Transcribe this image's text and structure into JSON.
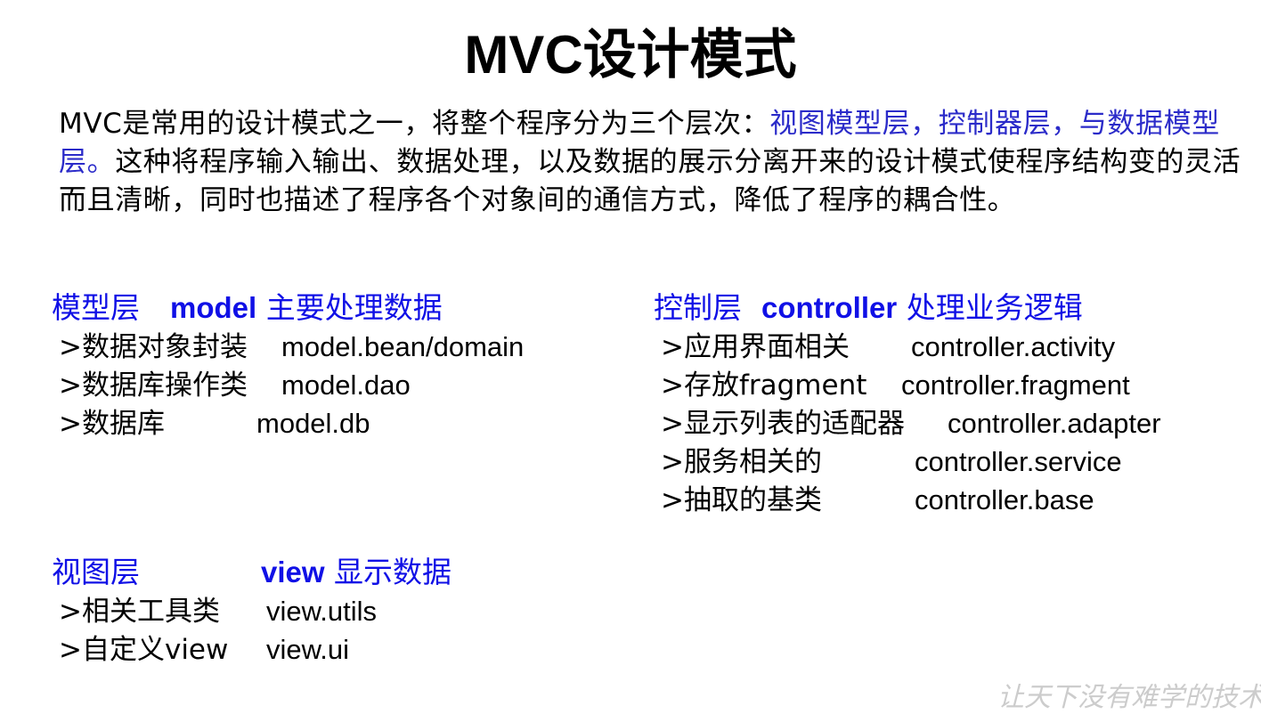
{
  "title": "MVC设计模式",
  "intro": {
    "part1": "MVC是常用的设计模式之一，将整个程序分为三个层次：",
    "highlight": "视图模型层，控制器层，与数据模型层。",
    "part2": "这种将程序输入输出、数据处理，以及数据的展示分离开来的设计模式使程序结构变的灵活而且清晰，同时也描述了程序各个对象间的通信方式，降低了程序的耦合性。"
  },
  "model": {
    "heading_label": "模型层",
    "heading_code": "model",
    "heading_desc": "主要处理数据",
    "items": [
      {
        "label": ">数据对象封装",
        "package": "model.bean/domain"
      },
      {
        "label": ">数据库操作类",
        "package": "model.dao"
      },
      {
        "label": ">数据库",
        "package": "model.db"
      }
    ]
  },
  "controller": {
    "heading_label": "控制层",
    "heading_code": "controller",
    "heading_desc": "处理业务逻辑",
    "items": [
      {
        "label": ">应用界面相关",
        "package": "controller.activity"
      },
      {
        "label": ">存放fragment",
        "package": "controller.fragment"
      },
      {
        "label": ">显示列表的适配器",
        "package": "controller.adapter"
      },
      {
        "label": ">服务相关的",
        "package": "controller.service"
      },
      {
        "label": ">抽取的基类",
        "package": "controller.base"
      }
    ]
  },
  "view": {
    "heading_label": "视图层",
    "heading_code": "view",
    "heading_desc": "显示数据",
    "items": [
      {
        "label": ">相关工具类",
        "package": "view.utils"
      },
      {
        "label": ">自定义view",
        "package": "view.ui"
      }
    ]
  },
  "watermark": "让天下没有难学的技术"
}
